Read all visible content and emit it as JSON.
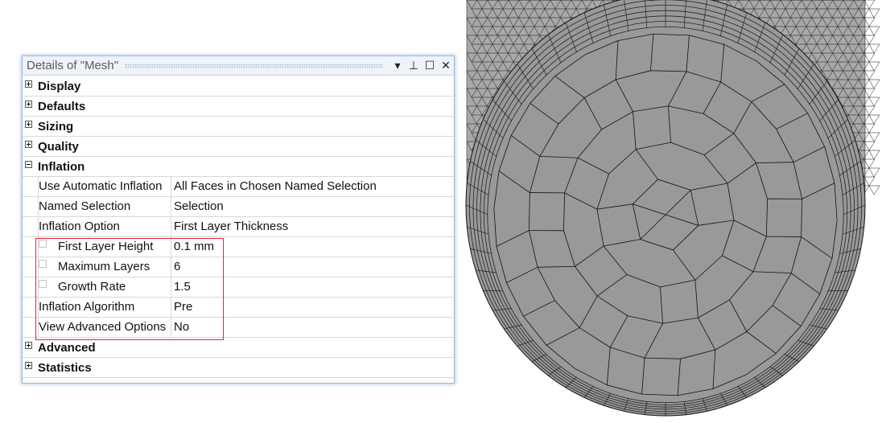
{
  "panel": {
    "title": "Details of \"Mesh\"",
    "buttons": {
      "dropdown": "▾",
      "pin": "⊥",
      "maximize": "☐",
      "close": "✕"
    }
  },
  "categories": {
    "display": "Display",
    "defaults": "Defaults",
    "sizing": "Sizing",
    "quality": "Quality",
    "inflation": "Inflation",
    "advanced": "Advanced",
    "statistics": "Statistics"
  },
  "inflation": {
    "use_automatic_inflation": {
      "label": "Use Automatic Inflation",
      "value": "All Faces in Chosen Named Selection"
    },
    "named_selection": {
      "label": "Named Selection",
      "value": "Selection"
    },
    "inflation_option": {
      "label": "Inflation Option",
      "value": "First Layer Thickness"
    },
    "first_layer_height": {
      "label": "First Layer Height",
      "value": "0.1 mm"
    },
    "maximum_layers": {
      "label": "Maximum Layers",
      "value": "6"
    },
    "growth_rate": {
      "label": "Growth Rate",
      "value": "1.5"
    },
    "inflation_algorithm": {
      "label": "Inflation Algorithm",
      "value": "Pre"
    },
    "view_advanced_options": {
      "label": "View Advanced Options",
      "value": "No"
    }
  },
  "colors": {
    "highlight": "#d9283a",
    "mesh_fill": "#999999",
    "mesh_edge": "#111111"
  }
}
